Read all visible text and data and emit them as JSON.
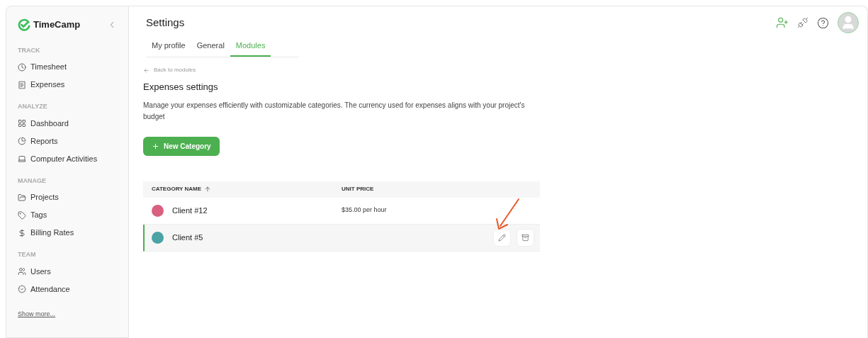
{
  "brand": "TimeCamp",
  "sidebar": {
    "sections": [
      {
        "heading": "TRACK",
        "items": [
          {
            "label": "Timesheet"
          },
          {
            "label": "Expenses"
          }
        ]
      },
      {
        "heading": "ANALYZE",
        "items": [
          {
            "label": "Dashboard"
          },
          {
            "label": "Reports"
          },
          {
            "label": "Computer Activities"
          }
        ]
      },
      {
        "heading": "MANAGE",
        "items": [
          {
            "label": "Projects"
          },
          {
            "label": "Tags"
          },
          {
            "label": "Billing Rates"
          }
        ]
      },
      {
        "heading": "TEAM",
        "items": [
          {
            "label": "Users"
          },
          {
            "label": "Attendance"
          }
        ]
      }
    ],
    "show_more": "Show more..."
  },
  "page_title": "Settings",
  "tabs": [
    {
      "label": "My profile",
      "selected": false
    },
    {
      "label": "General",
      "selected": false
    },
    {
      "label": "Modules",
      "selected": true
    }
  ],
  "back_link": "Back to modules",
  "section_title": "Expenses settings",
  "description": "Manage your expenses efficiently with customizable categories. The currency used for expenses aligns with your project's budget",
  "new_button": "New Category",
  "table": {
    "columns": [
      "CATEGORY NAME",
      "UNIT PRICE"
    ],
    "rows": [
      {
        "name": "Client #12",
        "color": "#d9607f",
        "unit_price": "$35.00 per hour",
        "selected": false
      },
      {
        "name": "Client #5",
        "color": "#4aa3a5",
        "selected": true
      }
    ]
  }
}
